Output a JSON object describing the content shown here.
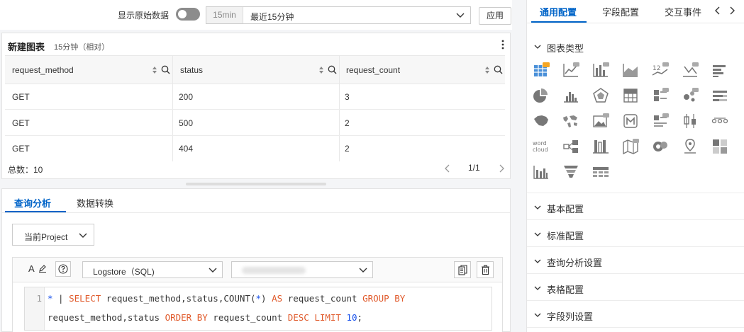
{
  "toolbar": {
    "raw_label": "显示原始数据",
    "time_tag": "15min",
    "time_text": "最近15分钟",
    "apply_label": "应用"
  },
  "chart": {
    "title": "新建图表",
    "subtitle": "15分钟（相对）",
    "columns": [
      "request_method",
      "status",
      "request_count"
    ],
    "rows": [
      [
        "GET",
        "200",
        "3"
      ],
      [
        "GET",
        "500",
        "2"
      ],
      [
        "GET",
        "404",
        "2"
      ]
    ],
    "total": "总数：10",
    "page": "1/1"
  },
  "query": {
    "tabs": [
      "查询分析",
      "数据转换"
    ],
    "project_label": "当前Project",
    "font_label": "A",
    "logstore_label": "Logstore（SQL)",
    "line_numbers": [
      "1"
    ]
  },
  "right": {
    "tabs": [
      "通用配置",
      "字段配置",
      "交互事件"
    ],
    "chart_type_title": "图表类型",
    "sections": [
      "基本配置",
      "标准配置",
      "查询分析设置",
      "表格配置",
      "字段列设置"
    ],
    "wordcloud_label": "word cloud"
  },
  "colors": {
    "accent": "#0064c8",
    "keyword": "#e0592a",
    "number": "#1750eb"
  }
}
